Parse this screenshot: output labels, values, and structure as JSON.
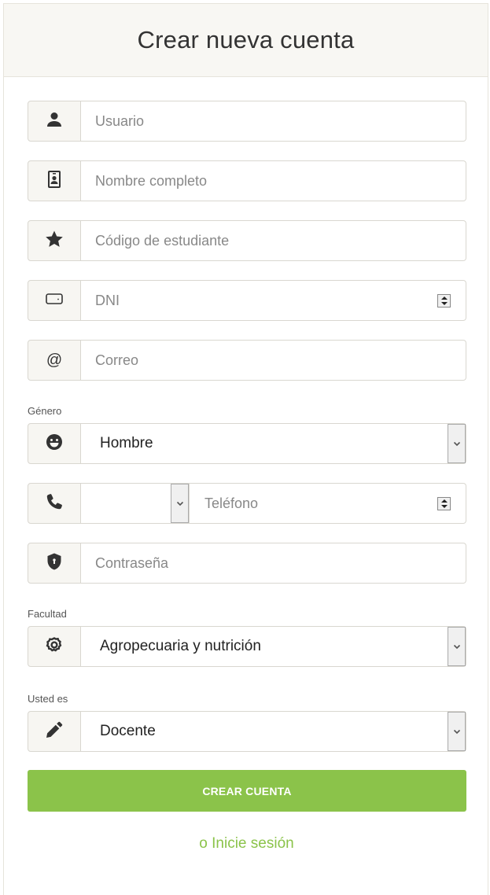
{
  "title": "Crear nueva cuenta",
  "fields": {
    "usuario": {
      "placeholder": "Usuario",
      "icon": "user-icon"
    },
    "nombre": {
      "placeholder": "Nombre completo",
      "icon": "id-badge-icon"
    },
    "codigo": {
      "placeholder": "Código de estudiante",
      "icon": "star-icon"
    },
    "dni": {
      "placeholder": "DNI",
      "icon": "id-card-icon"
    },
    "correo": {
      "placeholder": "Correo",
      "icon": "at-icon"
    },
    "genero": {
      "label": "Género",
      "value": "Hombre",
      "icon": "smile-icon"
    },
    "telefono": {
      "code_value": "",
      "placeholder": "Teléfono",
      "icon": "phone-icon"
    },
    "contrasena": {
      "placeholder": "Contraseña",
      "icon": "shield-icon"
    },
    "facultad": {
      "label": "Facultad",
      "value": "Agropecuaria y nutrición",
      "icon": "gear-icon"
    },
    "rol": {
      "label": "Usted es",
      "value": "Docente",
      "icon": "pencil-icon"
    }
  },
  "actions": {
    "submit_label": "CREAR CUENTA",
    "login_link": "o Inicie sesión"
  },
  "colors": {
    "accent": "#8bc34a",
    "header_bg": "#f8f7f3",
    "addon_bg": "#f7f6f2"
  }
}
